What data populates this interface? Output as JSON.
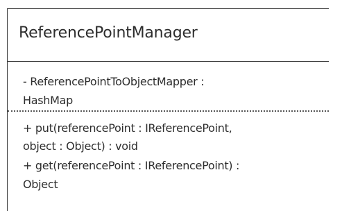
{
  "class": {
    "name": "ReferencePointManager",
    "attributes": [
      "- ReferencePointToObjectMapper :",
      "HashMap"
    ],
    "operations": [
      "+ put(referencePoint : IReferencePoint,",
      "object  : Object) : void",
      "+ get(referencePoint : IReferencePoint) :",
      "Object"
    ]
  }
}
